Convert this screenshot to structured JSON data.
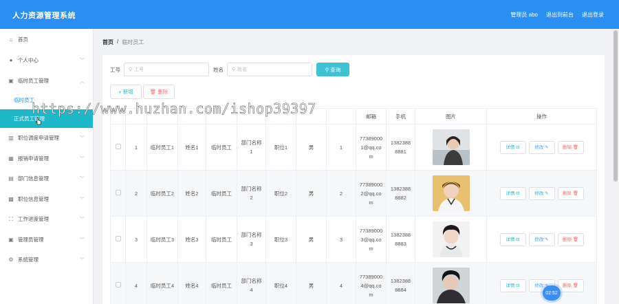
{
  "header": {
    "title": "人力资源管理系统",
    "admin": "管理员 abo",
    "back": "退出到前台",
    "logout": "退出登录"
  },
  "sidebar": {
    "items": [
      {
        "label": "首页",
        "icon": "home-icon",
        "chev": false
      },
      {
        "label": "个人中心",
        "icon": "user-icon",
        "chev": true
      },
      {
        "label": "临时员工管理",
        "icon": "briefcase-icon",
        "chev": true
      }
    ],
    "sub": [
      "临时员工",
      "正式员工管理"
    ],
    "items2": [
      {
        "label": "职位调度申请管理",
        "icon": "bank-icon"
      },
      {
        "label": "报销申请管理",
        "icon": "grid-icon"
      },
      {
        "label": "部门信息管理",
        "icon": "chart-icon"
      },
      {
        "label": "职位信息管理",
        "icon": "table-icon"
      },
      {
        "label": "工作进度管理",
        "icon": "expand-icon"
      },
      {
        "label": "管理员管理",
        "icon": "briefcase-icon"
      },
      {
        "label": "系统管理",
        "icon": "gear-icon"
      }
    ]
  },
  "breadcrumb": {
    "home": "首页",
    "sep": "/",
    "current": "临时员工"
  },
  "search": {
    "label_id": "工号",
    "placeholder_id": "工号",
    "label_name": "姓名",
    "placeholder_name": "姓名",
    "button": "查询"
  },
  "actions": {
    "add": "+ 新增",
    "delete": "删除"
  },
  "table": {
    "columns": [
      "",
      "",
      "",
      "",
      "",
      "",
      "",
      "",
      "",
      "邮箱",
      "手机",
      "图片",
      "操作"
    ],
    "rows": [
      {
        "idx": "1",
        "no": "临时员工1",
        "name": "姓名1",
        "type": "临时员工",
        "dept": "部门名称1",
        "pos": "职位1",
        "gender": "男",
        "age": "1",
        "email": "773890001@qq.com",
        "phone": "13823888881"
      },
      {
        "idx": "2",
        "no": "临时员工2",
        "name": "姓名2",
        "type": "临时员工",
        "dept": "部门名称2",
        "pos": "职位2",
        "gender": "男",
        "age": "2",
        "email": "773890002@qq.com",
        "phone": "13823888882"
      },
      {
        "idx": "3",
        "no": "临时员工3",
        "name": "姓名3",
        "type": "临时员工",
        "dept": "部门名称3",
        "pos": "职位3",
        "gender": "男",
        "age": "3",
        "email": "773890003@qq.com",
        "phone": "13823888883"
      },
      {
        "idx": "4",
        "no": "临时员工4",
        "name": "姓名4",
        "type": "临时员工",
        "dept": "部门名称4",
        "pos": "职位4",
        "gender": "男",
        "age": "4",
        "email": "773890004@qq.com",
        "phone": "13823888884"
      }
    ],
    "ops": {
      "detail": "详情",
      "edit": "修改",
      "delete": "删除"
    }
  },
  "watermark": "https://www.huzhan.com/ishop39397",
  "timer": "02:52",
  "colors": {
    "header": "#2a8ff0",
    "active": "#1fb8c8",
    "search": "#3fc2d3",
    "danger": "#f56c6c"
  }
}
